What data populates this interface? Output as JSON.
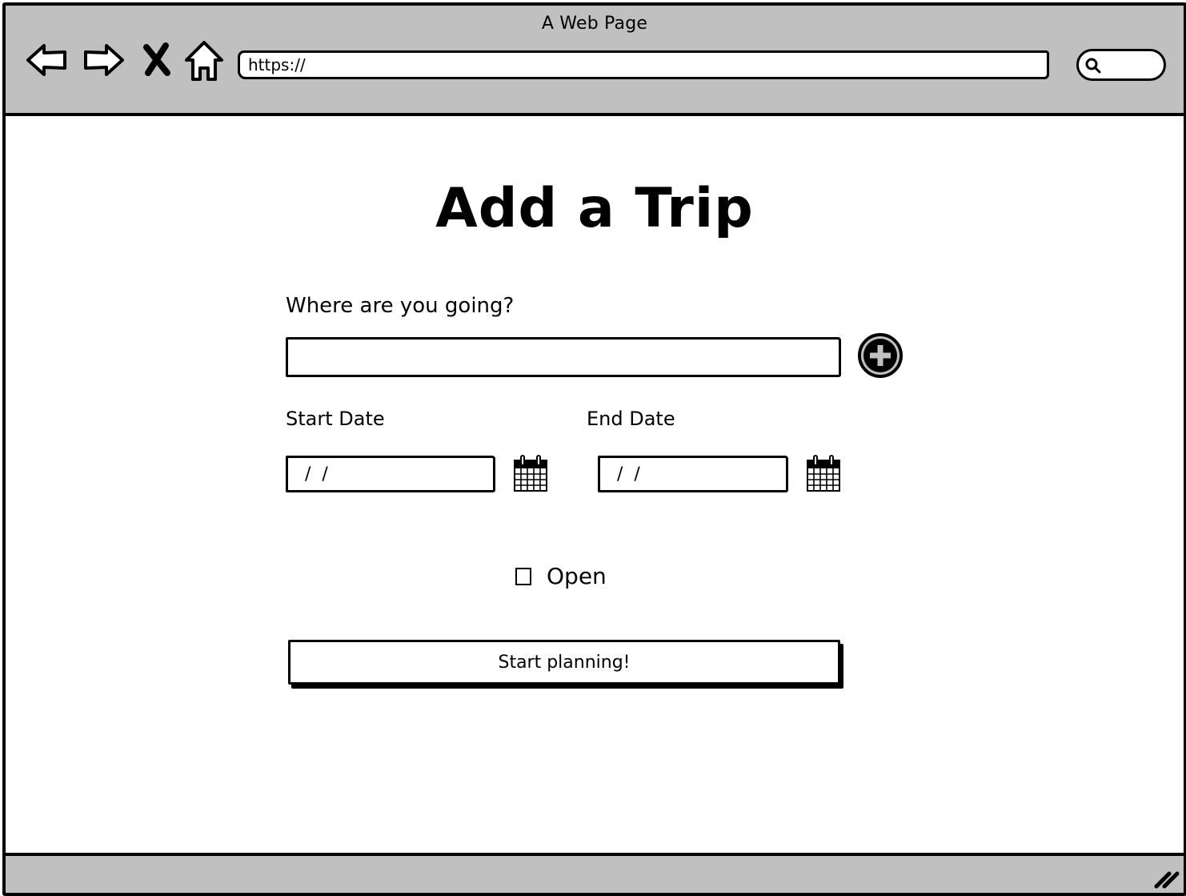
{
  "browser": {
    "window_title": "A Web Page",
    "url_value": "https://",
    "search_value": "",
    "nav_icons": [
      "back-arrow-icon",
      "forward-arrow-icon",
      "stop-x-icon",
      "home-icon"
    ]
  },
  "form": {
    "title": "Add a Trip",
    "destination": {
      "label": "Where are you going?",
      "value": "",
      "add_icon": "plus-circle-icon"
    },
    "start_date": {
      "label": "Start Date",
      "value": " /  /",
      "icon": "calendar-icon"
    },
    "end_date": {
      "label": "End Date",
      "value": " /  /",
      "icon": "calendar-icon"
    },
    "open_checkbox": {
      "label": "Open",
      "checked": false
    },
    "submit_label": "Start planning!"
  },
  "colors": {
    "chrome_gray": "#c0c0c0",
    "ink": "#000000",
    "background": "#ffffff"
  }
}
